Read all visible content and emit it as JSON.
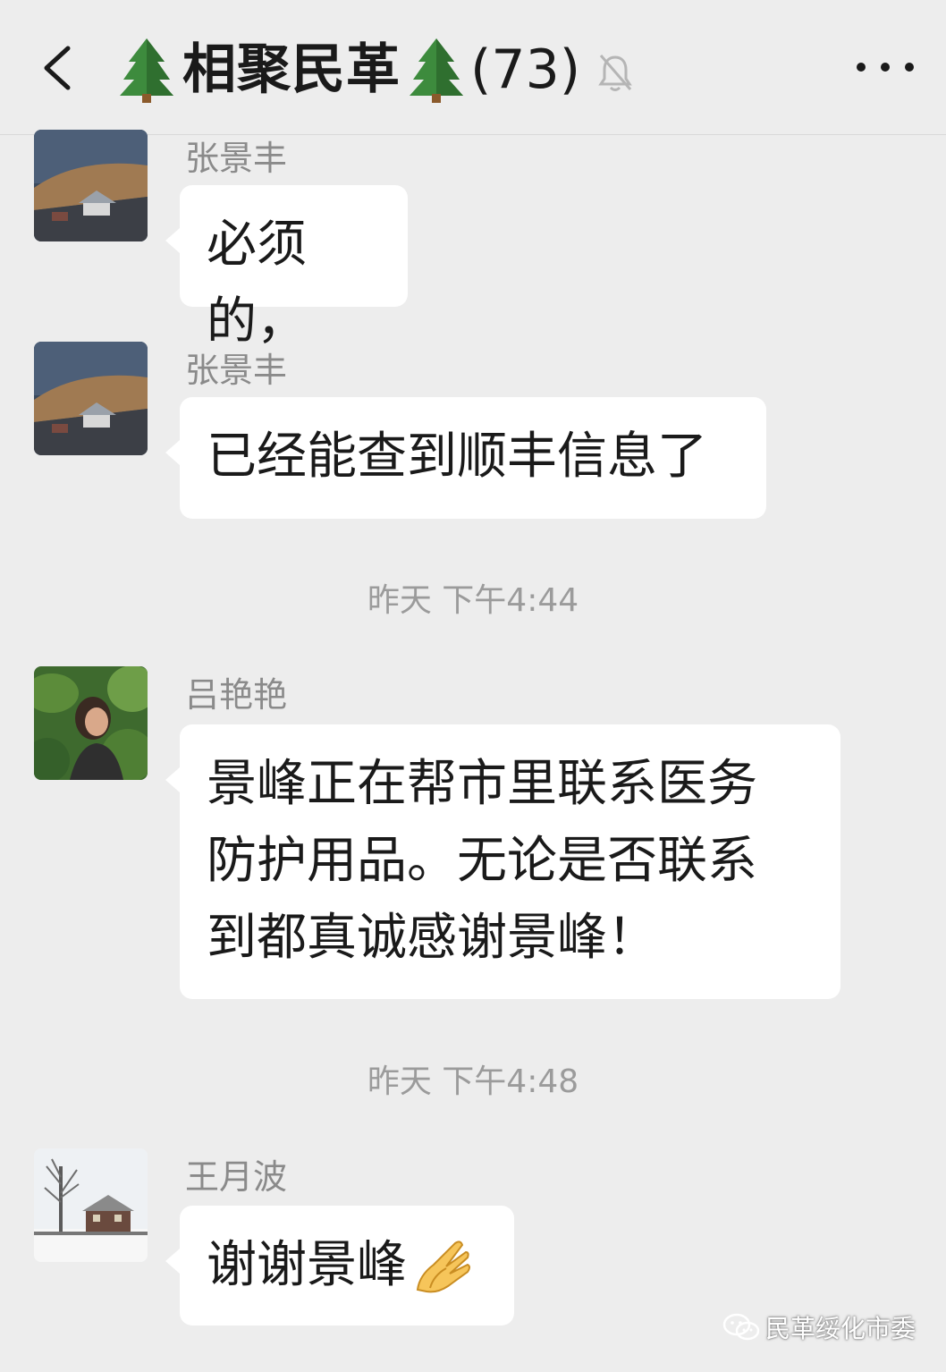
{
  "header": {
    "title": "相聚民革",
    "member_count": "(73)",
    "icons": {
      "back": "chevron-left-icon",
      "tree_left": "tree-icon",
      "tree_right": "tree-icon",
      "mute": "bell-muted-icon",
      "more": "more-dots-icon"
    }
  },
  "messages": [
    {
      "sender": "张景丰",
      "text": "必须的，",
      "avatar": "avatar-landscape"
    },
    {
      "sender": "张景丰",
      "text": "已经能查到顺丰信息了",
      "avatar": "avatar-landscape"
    },
    {
      "sender": "吕艳艳",
      "text_lines": [
        "景峰正在帮市里联系医务",
        "防护用品。无论是否联系",
        "到都真诚感谢景峰！"
      ],
      "avatar": "avatar-woman-plants"
    },
    {
      "sender": "王月波",
      "text": "谢谢景峰",
      "emoji": "folded-hands-icon",
      "avatar": "avatar-winter-house"
    }
  ],
  "timestamps": [
    "昨天 下午4:44",
    "昨天 下午4:48"
  ],
  "watermark": {
    "text": "民革绥化市委",
    "icon": "wechat-icon"
  },
  "colors": {
    "background": "#ededed",
    "bubble": "#ffffff",
    "sender_name": "#8a8a8a",
    "timestamp": "#9b9b9b"
  }
}
